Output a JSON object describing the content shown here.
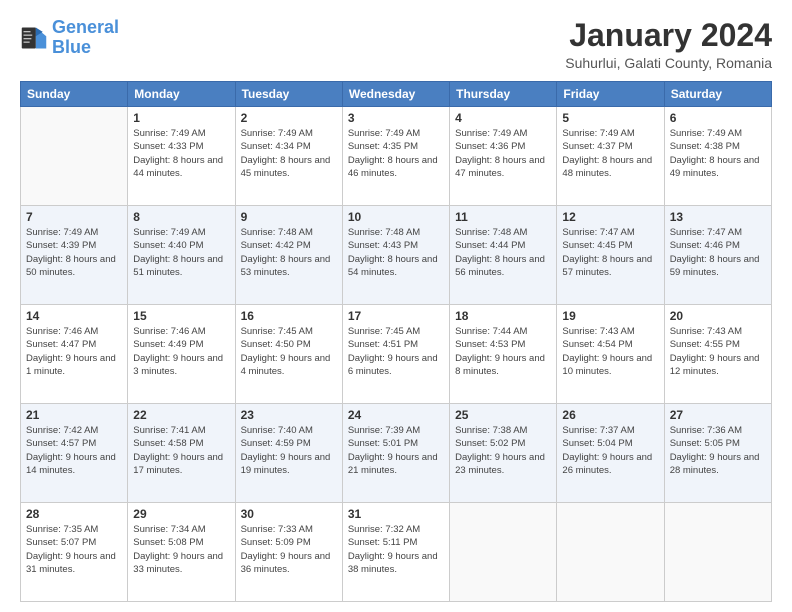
{
  "header": {
    "logo": {
      "line1": "General",
      "line2": "Blue"
    },
    "title": "January 2024",
    "subtitle": "Suhurlui, Galati County, Romania"
  },
  "calendar": {
    "days_of_week": [
      "Sunday",
      "Monday",
      "Tuesday",
      "Wednesday",
      "Thursday",
      "Friday",
      "Saturday"
    ],
    "weeks": [
      [
        {
          "day": "",
          "empty": true
        },
        {
          "day": "1",
          "sunrise": "Sunrise: 7:49 AM",
          "sunset": "Sunset: 4:33 PM",
          "daylight": "Daylight: 8 hours and 44 minutes."
        },
        {
          "day": "2",
          "sunrise": "Sunrise: 7:49 AM",
          "sunset": "Sunset: 4:34 PM",
          "daylight": "Daylight: 8 hours and 45 minutes."
        },
        {
          "day": "3",
          "sunrise": "Sunrise: 7:49 AM",
          "sunset": "Sunset: 4:35 PM",
          "daylight": "Daylight: 8 hours and 46 minutes."
        },
        {
          "day": "4",
          "sunrise": "Sunrise: 7:49 AM",
          "sunset": "Sunset: 4:36 PM",
          "daylight": "Daylight: 8 hours and 47 minutes."
        },
        {
          "day": "5",
          "sunrise": "Sunrise: 7:49 AM",
          "sunset": "Sunset: 4:37 PM",
          "daylight": "Daylight: 8 hours and 48 minutes."
        },
        {
          "day": "6",
          "sunrise": "Sunrise: 7:49 AM",
          "sunset": "Sunset: 4:38 PM",
          "daylight": "Daylight: 8 hours and 49 minutes."
        }
      ],
      [
        {
          "day": "7",
          "sunrise": "Sunrise: 7:49 AM",
          "sunset": "Sunset: 4:39 PM",
          "daylight": "Daylight: 8 hours and 50 minutes."
        },
        {
          "day": "8",
          "sunrise": "Sunrise: 7:49 AM",
          "sunset": "Sunset: 4:40 PM",
          "daylight": "Daylight: 8 hours and 51 minutes."
        },
        {
          "day": "9",
          "sunrise": "Sunrise: 7:48 AM",
          "sunset": "Sunset: 4:42 PM",
          "daylight": "Daylight: 8 hours and 53 minutes."
        },
        {
          "day": "10",
          "sunrise": "Sunrise: 7:48 AM",
          "sunset": "Sunset: 4:43 PM",
          "daylight": "Daylight: 8 hours and 54 minutes."
        },
        {
          "day": "11",
          "sunrise": "Sunrise: 7:48 AM",
          "sunset": "Sunset: 4:44 PM",
          "daylight": "Daylight: 8 hours and 56 minutes."
        },
        {
          "day": "12",
          "sunrise": "Sunrise: 7:47 AM",
          "sunset": "Sunset: 4:45 PM",
          "daylight": "Daylight: 8 hours and 57 minutes."
        },
        {
          "day": "13",
          "sunrise": "Sunrise: 7:47 AM",
          "sunset": "Sunset: 4:46 PM",
          "daylight": "Daylight: 8 hours and 59 minutes."
        }
      ],
      [
        {
          "day": "14",
          "sunrise": "Sunrise: 7:46 AM",
          "sunset": "Sunset: 4:47 PM",
          "daylight": "Daylight: 9 hours and 1 minute."
        },
        {
          "day": "15",
          "sunrise": "Sunrise: 7:46 AM",
          "sunset": "Sunset: 4:49 PM",
          "daylight": "Daylight: 9 hours and 3 minutes."
        },
        {
          "day": "16",
          "sunrise": "Sunrise: 7:45 AM",
          "sunset": "Sunset: 4:50 PM",
          "daylight": "Daylight: 9 hours and 4 minutes."
        },
        {
          "day": "17",
          "sunrise": "Sunrise: 7:45 AM",
          "sunset": "Sunset: 4:51 PM",
          "daylight": "Daylight: 9 hours and 6 minutes."
        },
        {
          "day": "18",
          "sunrise": "Sunrise: 7:44 AM",
          "sunset": "Sunset: 4:53 PM",
          "daylight": "Daylight: 9 hours and 8 minutes."
        },
        {
          "day": "19",
          "sunrise": "Sunrise: 7:43 AM",
          "sunset": "Sunset: 4:54 PM",
          "daylight": "Daylight: 9 hours and 10 minutes."
        },
        {
          "day": "20",
          "sunrise": "Sunrise: 7:43 AM",
          "sunset": "Sunset: 4:55 PM",
          "daylight": "Daylight: 9 hours and 12 minutes."
        }
      ],
      [
        {
          "day": "21",
          "sunrise": "Sunrise: 7:42 AM",
          "sunset": "Sunset: 4:57 PM",
          "daylight": "Daylight: 9 hours and 14 minutes."
        },
        {
          "day": "22",
          "sunrise": "Sunrise: 7:41 AM",
          "sunset": "Sunset: 4:58 PM",
          "daylight": "Daylight: 9 hours and 17 minutes."
        },
        {
          "day": "23",
          "sunrise": "Sunrise: 7:40 AM",
          "sunset": "Sunset: 4:59 PM",
          "daylight": "Daylight: 9 hours and 19 minutes."
        },
        {
          "day": "24",
          "sunrise": "Sunrise: 7:39 AM",
          "sunset": "Sunset: 5:01 PM",
          "daylight": "Daylight: 9 hours and 21 minutes."
        },
        {
          "day": "25",
          "sunrise": "Sunrise: 7:38 AM",
          "sunset": "Sunset: 5:02 PM",
          "daylight": "Daylight: 9 hours and 23 minutes."
        },
        {
          "day": "26",
          "sunrise": "Sunrise: 7:37 AM",
          "sunset": "Sunset: 5:04 PM",
          "daylight": "Daylight: 9 hours and 26 minutes."
        },
        {
          "day": "27",
          "sunrise": "Sunrise: 7:36 AM",
          "sunset": "Sunset: 5:05 PM",
          "daylight": "Daylight: 9 hours and 28 minutes."
        }
      ],
      [
        {
          "day": "28",
          "sunrise": "Sunrise: 7:35 AM",
          "sunset": "Sunset: 5:07 PM",
          "daylight": "Daylight: 9 hours and 31 minutes."
        },
        {
          "day": "29",
          "sunrise": "Sunrise: 7:34 AM",
          "sunset": "Sunset: 5:08 PM",
          "daylight": "Daylight: 9 hours and 33 minutes."
        },
        {
          "day": "30",
          "sunrise": "Sunrise: 7:33 AM",
          "sunset": "Sunset: 5:09 PM",
          "daylight": "Daylight: 9 hours and 36 minutes."
        },
        {
          "day": "31",
          "sunrise": "Sunrise: 7:32 AM",
          "sunset": "Sunset: 5:11 PM",
          "daylight": "Daylight: 9 hours and 38 minutes."
        },
        {
          "day": "",
          "empty": true
        },
        {
          "day": "",
          "empty": true
        },
        {
          "day": "",
          "empty": true
        }
      ]
    ]
  }
}
